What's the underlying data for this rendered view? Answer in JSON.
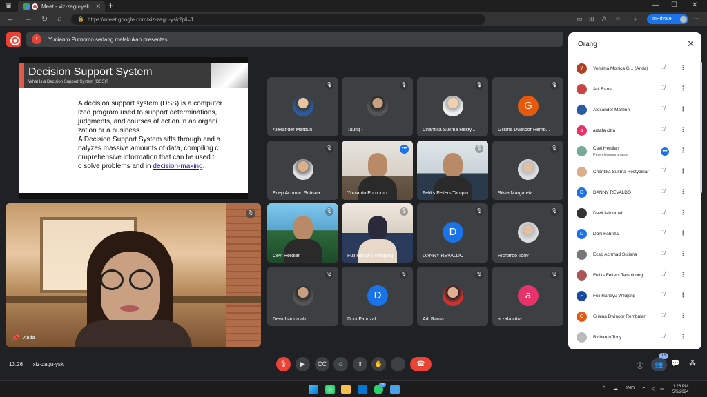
{
  "browser": {
    "tab_title": "Meet - xiz-zagu-ysk",
    "url": "https://meet.google.com/xiz-zagu-ysk?pli=1",
    "inprivate_label": "InPrivate"
  },
  "banner": {
    "avatar_letter": "Y",
    "text": "Yunianto Purnomo sedang melakukan presentasi"
  },
  "slide": {
    "title": "Decision Support System",
    "subtitle": "What Is a Decision Support System (DSS)?",
    "body_lines": [
      "A decision support system (DSS) is a computer",
      "ized program used to support determinations,",
      "judgments, and courses of action in an organi",
      "zation or a business.",
      "A Decision Support System sifts through and a",
      "nalyzes massive amounts of data, compiling c",
      "omprehensive information that can be used t"
    ],
    "last_line_prefix": "o solve problems and in ",
    "link_text": "decision-making",
    "last_line_suffix": "."
  },
  "self_view": {
    "name": "Anda"
  },
  "tiles": [
    {
      "name": "Alexander Marbun",
      "avatar": "photo"
    },
    {
      "name": "Taufiq -",
      "avatar": "photo"
    },
    {
      "name": "Chantika Sukma Resty...",
      "avatar": "photo"
    },
    {
      "name": "Glisina Dwinoor Remb...",
      "avatar": "G",
      "color": "#e8590c"
    },
    {
      "name": "Ecep Achmad Sutisna",
      "avatar": "photo"
    },
    {
      "name": "Yunianto Purnomo",
      "avatar": "video"
    },
    {
      "name": "Feliks Feiters Tampin...",
      "avatar": "video"
    },
    {
      "name": "Silvia Margareta",
      "avatar": "photo"
    },
    {
      "name": "Cevi Herdian",
      "avatar": "video"
    },
    {
      "name": "Fuji Rahayu Wilujeng",
      "avatar": "video"
    },
    {
      "name": "DANNY REVALDO",
      "avatar": "D",
      "color": "#1a73e8"
    },
    {
      "name": "Richardo Tony",
      "avatar": "photo"
    },
    {
      "name": "Dewi Istiqomah",
      "avatar": "photo"
    },
    {
      "name": "Doni Fahrizal",
      "avatar": "D",
      "color": "#1a73e8"
    },
    {
      "name": "Adi Rama",
      "avatar": "photo"
    },
    {
      "name": "arzafa citra",
      "avatar": "a",
      "color": "#e8336a"
    }
  ],
  "bottom": {
    "time": "13.26",
    "separator": "|",
    "meeting_code": "xiz-zagu-ysk",
    "people_count": "18"
  },
  "panel": {
    "title": "Orang",
    "people": [
      {
        "name": "Yemima Monica G... (Anda)",
        "letter": "Y",
        "color": "#b04020"
      },
      {
        "name": "Adi Rama",
        "letter": "",
        "color": "#c44"
      },
      {
        "name": "Alexander Marbun",
        "letter": "",
        "color": "#2a5aa0"
      },
      {
        "name": "arzafa citra",
        "letter": "a",
        "color": "#e8336a"
      },
      {
        "name": "Cevi Herdian",
        "role": "Penyelenggara rapat",
        "letter": "",
        "color": "#7a9"
      },
      {
        "name": "Chantika Sukma Restydinar",
        "letter": "",
        "color": "#d9b08a"
      },
      {
        "name": "DANNY REVALDO",
        "letter": "D",
        "color": "#1a73e8"
      },
      {
        "name": "Dewi Istiqomah",
        "letter": "",
        "color": "#333"
      },
      {
        "name": "Doni Fahrizal",
        "letter": "D",
        "color": "#1a73e8"
      },
      {
        "name": "Ecep Achmad Sutisna",
        "letter": "",
        "color": "#777"
      },
      {
        "name": "Feliks Feiters Tampinong...",
        "letter": "",
        "color": "#a55"
      },
      {
        "name": "Fuji Rahayu Wilujeng",
        "letter": "F",
        "color": "#1a4aa0"
      },
      {
        "name": "Glisina Dwinoor Rembulan",
        "letter": "G",
        "color": "#e8590c"
      },
      {
        "name": "Richardo Tony",
        "letter": "",
        "color": "#bbb"
      }
    ]
  },
  "taskbar": {
    "lang": "IND",
    "clock_time": "1:26 PM",
    "clock_date": "5/5/2024",
    "edge_badge": "37"
  }
}
